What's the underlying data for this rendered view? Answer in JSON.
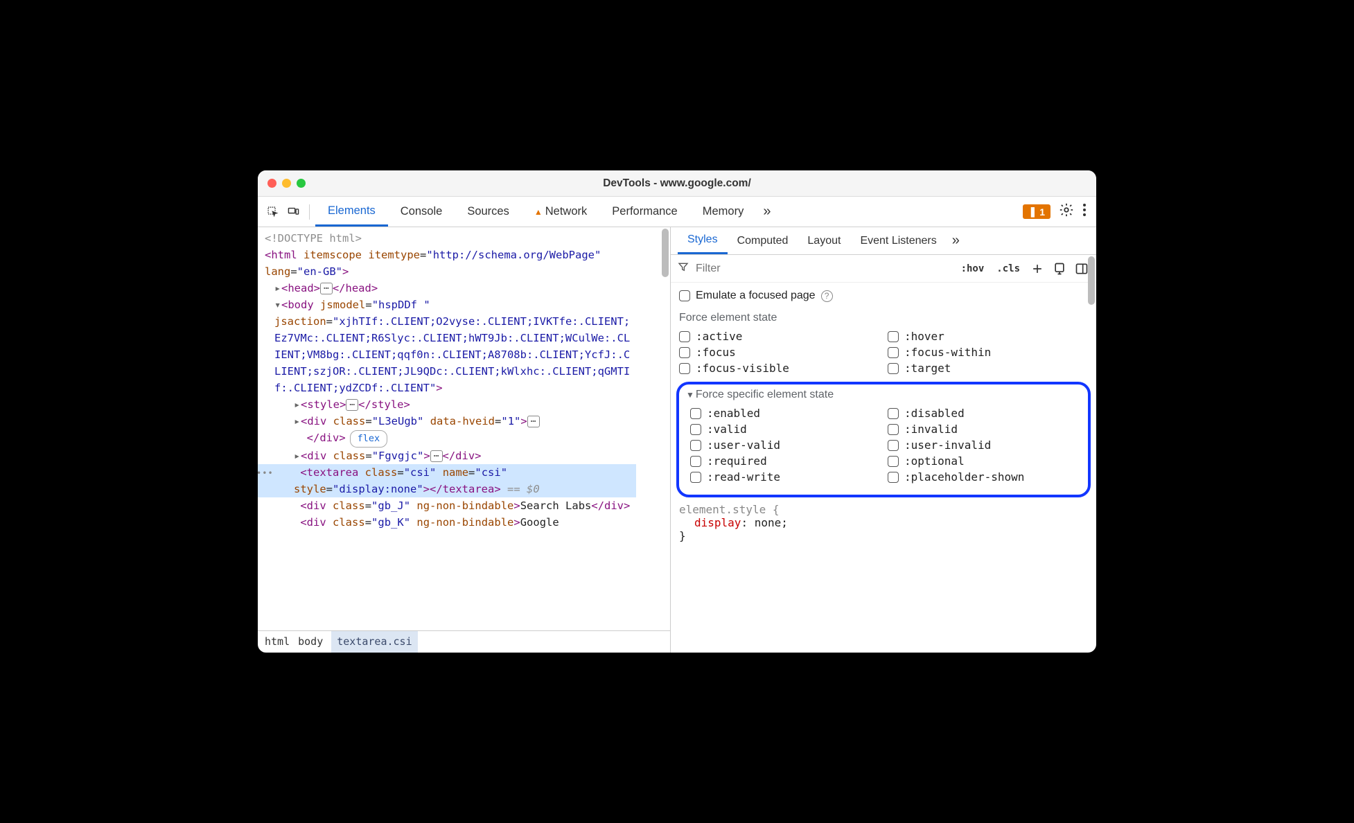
{
  "window_title": "DevTools - www.google.com/",
  "toolbar": {
    "tabs": [
      "Elements",
      "Console",
      "Sources",
      "Network",
      "Performance",
      "Memory"
    ],
    "active_tab": "Elements",
    "warning_tab": "Network",
    "more_label": "»",
    "issues_count": "1"
  },
  "tree": {
    "doctype": "<!DOCTYPE html>",
    "html_open": "<html itemscope itemtype=\"http://schema.org/WebPage\" lang=\"en-GB\">",
    "head": "<head>⋯</head>",
    "body_open": "<body jsmodel=\"hspDDf \" jsaction=\"xjhTIf:.CLIENT;O2vyse:.CLIENT;IVKTfe:.CLIENT;Ez7VMc:.CLIENT;R6Slyc:.CLIENT;hWT9Jb:.CLIENT;WCulWe:.CLIENT;VM8bg:.CLIENT;qqf0n:.CLIENT;A8708b:.CLIENT;YcfJ:.CLIENT;szjOR:.CLIENT;JL9QDc:.CLIENT;kWlxhc:.CLIENT;qGMTIf:.CLIENT;ydZCDf:.CLIENT\">",
    "style_row": "<style>⋯</style>",
    "div1": "<div class=\"L3eUgb\" data-hveid=\"1\">⋯</div>",
    "flex_pill": "flex",
    "div2": "<div class=\"Fgvgjc\">⋯</div>",
    "textarea_row": "<textarea class=\"csi\" name=\"csi\" style=\"display:none\"></textarea>",
    "eq_zero": " == $0",
    "div3a": "<div class=\"gb_J\" ng-non-bindable>Search Labs</div>",
    "div3b": "<div class=\"gb_K\" ng-non-bindable>Google"
  },
  "breadcrumbs": [
    "html",
    "body",
    "textarea.csi"
  ],
  "styles_panel": {
    "tabs": [
      "Styles",
      "Computed",
      "Layout",
      "Event Listeners"
    ],
    "active_tab": "Styles",
    "more": "»",
    "filter_placeholder": "Filter",
    "hov": ":hov",
    "cls": ".cls",
    "emulate_label": "Emulate a focused page",
    "force_heading": "Force element state",
    "force_states": [
      ":active",
      ":hover",
      ":focus",
      ":focus-within",
      ":focus-visible",
      ":target"
    ],
    "specific_heading": "Force specific element state",
    "specific_states": [
      ":enabled",
      ":disabled",
      ":valid",
      ":invalid",
      ":user-valid",
      ":user-invalid",
      ":required",
      ":optional",
      ":read-write",
      ":placeholder-shown"
    ],
    "style_rule": {
      "selector": "element.style {",
      "prop": "display",
      "val": "none",
      "close": "}"
    }
  }
}
